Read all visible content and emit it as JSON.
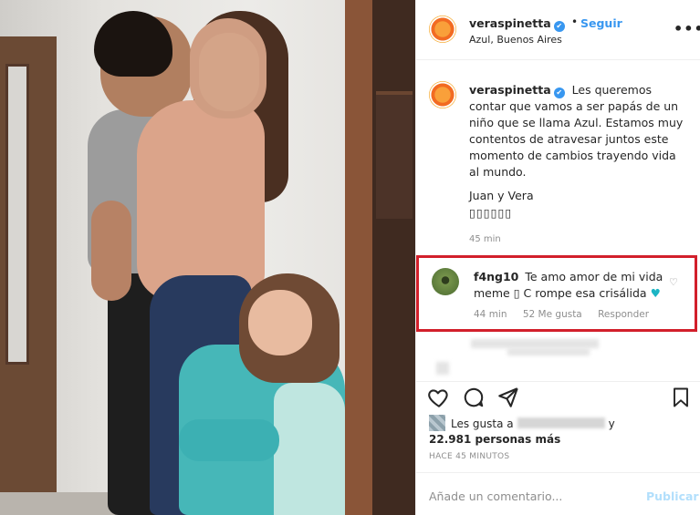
{
  "post": {
    "username": "veraspinetta",
    "verified_glyph": "✔",
    "separator": "•",
    "follow_label": "Seguir",
    "location": "Azul, Buenos Aires",
    "more_label": "•••"
  },
  "caption": {
    "username": "veraspinetta",
    "text": "Les queremos contar que vamos a ser papás de un niño que se llama Azul. Estamos muy contentos de atravesar juntos este momento de cambios trayendo vida al mundo.",
    "signature": "Juan y Vera",
    "emoji": "▯▯▯▯▯▯",
    "time": "45 min"
  },
  "comment": {
    "username": "f4ng10",
    "text": "Te amo amor de mi vida meme ▯ C rompe esa crisálida",
    "heart": "♥",
    "like_icon": "♡",
    "time": "44 min",
    "likes": "52 Me gusta",
    "reply_label": "Responder"
  },
  "likes": {
    "prefix": "Les gusta a",
    "suffix": "y",
    "count": "22.981 personas más"
  },
  "timestamp": "HACE 45 MINUTOS",
  "add_comment": {
    "placeholder": "Añade un comentario...",
    "publish_label": "Publicar"
  },
  "colors": {
    "link_blue": "#3897f0",
    "highlight_red": "#d21f2b",
    "teal_heart": "#1cb5c4"
  }
}
